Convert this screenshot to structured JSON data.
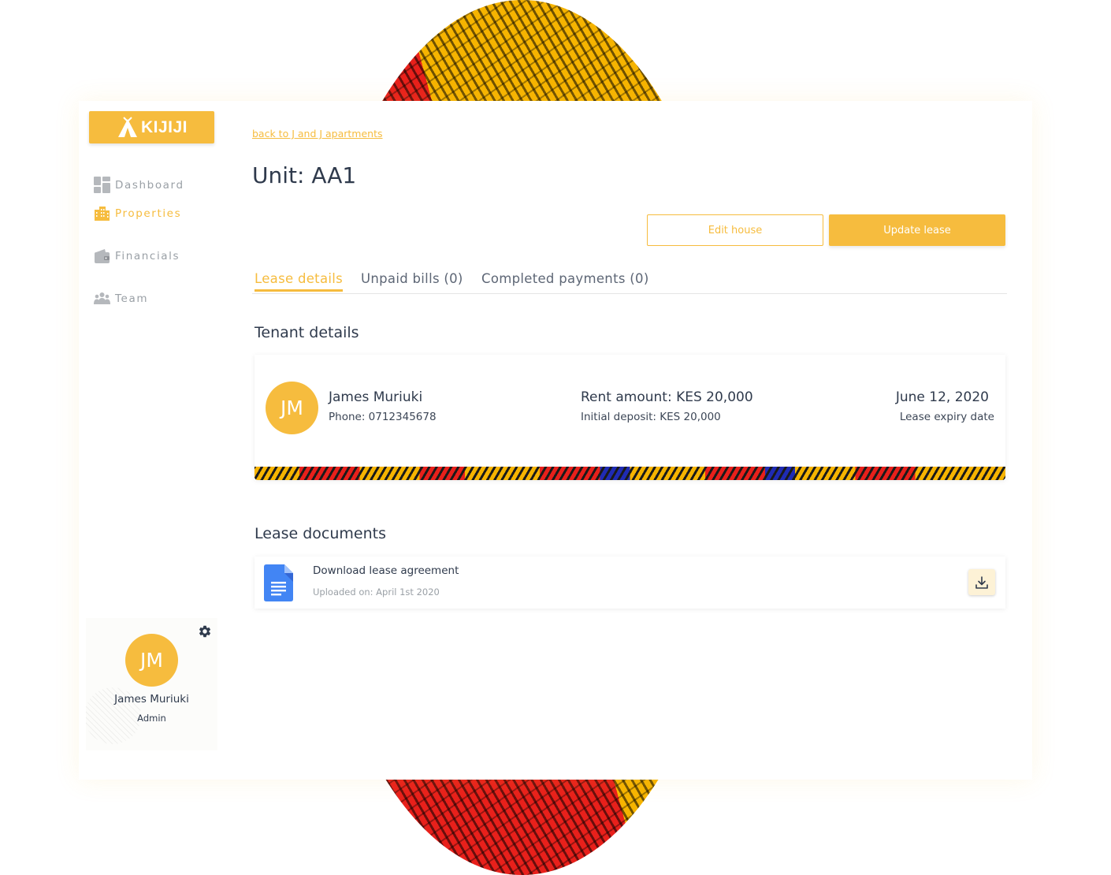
{
  "brand": {
    "logo_text": "KIJIJI",
    "accent_color": "#f6bc3e"
  },
  "sidebar": {
    "items": [
      {
        "label": "Dashboard",
        "icon": "dashboard-icon",
        "active": false
      },
      {
        "label": "Properties",
        "icon": "building-icon",
        "active": true
      },
      {
        "label": "Financials",
        "icon": "wallet-icon",
        "active": false
      },
      {
        "label": "Team",
        "icon": "team-icon",
        "active": false
      }
    ],
    "profile": {
      "initials": "JM",
      "name": "James Muriuki",
      "role": "Admin",
      "settings_icon": "gear-icon"
    }
  },
  "main": {
    "back_link": "back to J and J apartments",
    "title": "Unit: AA1",
    "buttons": {
      "edit": "Edit house",
      "update": "Update lease"
    },
    "tabs": [
      {
        "label": "Lease details",
        "active": true
      },
      {
        "label": "Unpaid bills (0)",
        "active": false
      },
      {
        "label": "Completed payments (0)",
        "active": false
      }
    ],
    "tenant_section_title": "Tenant details",
    "tenant": {
      "initials": "JM",
      "name": "James Muriuki",
      "phone": "Phone: 0712345678",
      "rent": "Rent amount: KES 20,000",
      "deposit": "Initial deposit: KES 20,000",
      "expiry_date": "June 12, 2020",
      "expiry_label": "Lease expiry date"
    },
    "documents_section_title": "Lease documents",
    "documents": [
      {
        "title": "Download lease agreement",
        "uploaded": "Uploaded on: April 1st 2020",
        "icon": "google-doc-icon",
        "action_icon": "download-icon"
      }
    ]
  }
}
